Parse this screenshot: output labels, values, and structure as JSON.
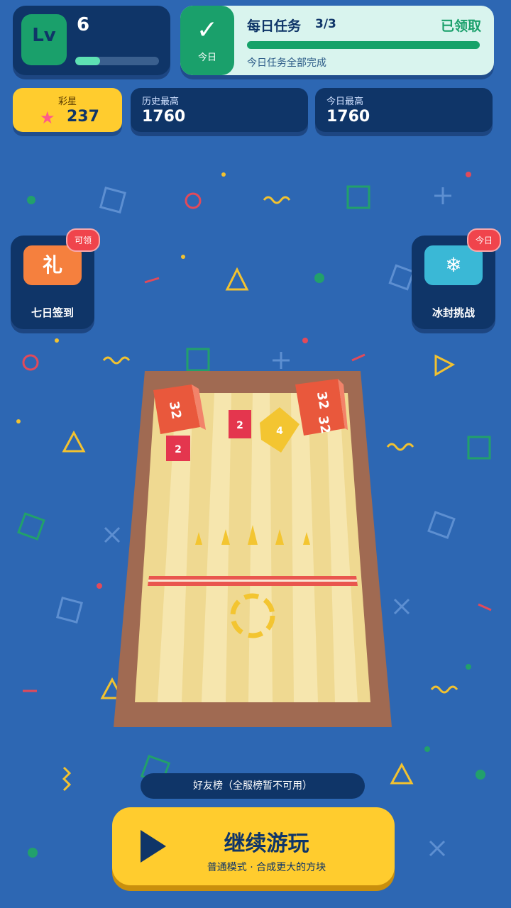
{
  "level": {
    "badge": "Lv",
    "value": "6",
    "progress": 0.3
  },
  "daily_task": {
    "check_icon": "✓",
    "today_label": "今日",
    "title": "每日任务",
    "count": "3/3",
    "status": "已领取",
    "progress": 1.0,
    "subtitle": "今日任务全部完成"
  },
  "stars": {
    "label": "彩星",
    "value": "237",
    "icon": "star-icon"
  },
  "history_best": {
    "label": "历史最高",
    "value": "1760"
  },
  "today_best": {
    "label": "今日最高",
    "value": "1760"
  },
  "signin": {
    "icon_text": "礼",
    "label": "七日签到",
    "badge": "可领"
  },
  "ice": {
    "icon_text": "❄",
    "label": "冰封挑战",
    "badge": "今日"
  },
  "board": {
    "cubes": [
      "32",
      "32",
      "2",
      "2",
      "4",
      "32"
    ]
  },
  "friends_bar": {
    "label": "好友榜（全服榜暂不可用）"
  },
  "play": {
    "title": "继续游玩",
    "subtitle": "普通模式 · 合成更大的方块"
  },
  "colors": {
    "background": "#2d67b3",
    "panel": "#0f3568",
    "accent_green": "#1aa06b",
    "accent_yellow": "#ffcc2e",
    "badge_red": "#f0444c"
  }
}
